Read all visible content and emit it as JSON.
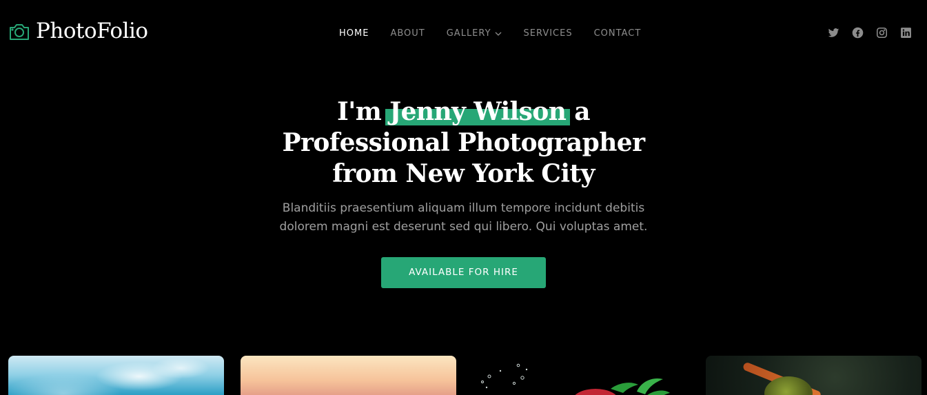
{
  "brand": {
    "name": "PhotoFolio",
    "icon": "camera-icon",
    "accent_color": "#27a776"
  },
  "nav": {
    "items": [
      {
        "label": "HOME",
        "active": true
      },
      {
        "label": "ABOUT",
        "active": false
      },
      {
        "label": "GALLERY",
        "active": false,
        "icon": "chevron-down-icon"
      },
      {
        "label": "SERVICES",
        "active": false
      },
      {
        "label": "CONTACT",
        "active": false
      }
    ]
  },
  "social": [
    {
      "icon": "twitter-icon"
    },
    {
      "icon": "facebook-icon"
    },
    {
      "icon": "instagram-icon"
    },
    {
      "icon": "linkedin-icon"
    }
  ],
  "hero": {
    "title_prefix": "I'm",
    "title_name": "Jenny Wilson",
    "title_after_name": "a",
    "title_line2": "Professional Photographer",
    "title_line3": "from New York City",
    "description": "Blanditiis praesentium aliquam illum tempore incidunt debitis dolorem magni est deserunt sed qui libero. Qui voluptas amet.",
    "cta_label": "AVAILABLE FOR HIRE"
  },
  "gallery": {
    "tiles": [
      {
        "subject": "ocean wave"
      },
      {
        "subject": "sunset sky"
      },
      {
        "subject": "strawberry splash"
      },
      {
        "subject": "insect macro"
      }
    ]
  }
}
